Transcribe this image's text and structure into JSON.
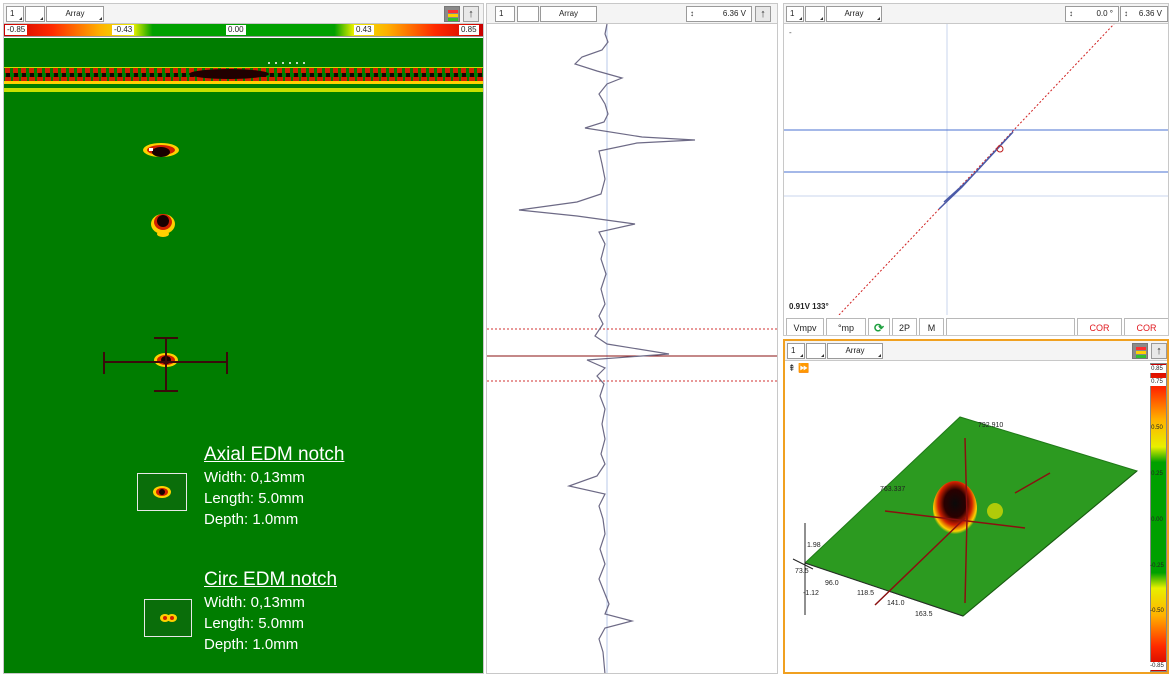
{
  "cscan_panel": {
    "toolbar": {
      "channel": "1",
      "array_label": "Array"
    },
    "colorbar": {
      "labels": [
        "-0.85",
        "-0.43",
        "0.00",
        "0.43",
        "0.85"
      ]
    },
    "notches": [
      {
        "title": "Axial EDM notch",
        "lines": [
          "Width: 0,13mm",
          "Length: 5.0mm",
          "Depth: 1.0mm"
        ]
      },
      {
        "title": "Circ EDM notch",
        "lines": [
          "Width: 0,13mm",
          "Length: 5.0mm",
          "Depth: 1.0mm"
        ]
      }
    ]
  },
  "strip_panel": {
    "toolbar": {
      "channel": "1",
      "array_label": "Array",
      "span_value": "6.36 V"
    }
  },
  "lissajous_panel": {
    "toolbar": {
      "channel": "1",
      "array_label": "Array",
      "rotation_value": "0.0 °",
      "span_value": "6.36 V"
    },
    "readout": "0.91V 133°",
    "buttons": [
      "Vmpv",
      "°mp",
      "2P",
      "M",
      "COR",
      "COR"
    ]
  },
  "view3d_panel": {
    "toolbar": {
      "channel": "1",
      "array_label": "Array"
    },
    "axis_labels": [
      "792.910",
      "763.337",
      "1.98",
      "73.5",
      "-1.12",
      "96.0",
      "118.5",
      "141.0",
      "163.5"
    ],
    "colorbar_labels": [
      "0.85",
      "0.75",
      "0.50",
      "0.25",
      "0.00",
      "-0.25",
      "-0.50",
      "-0.85"
    ]
  },
  "colors": {
    "cscan_background": "#007d00",
    "active_border": "#f0a020",
    "trace": "#6d6a86",
    "reference_line": "#8a1010"
  }
}
